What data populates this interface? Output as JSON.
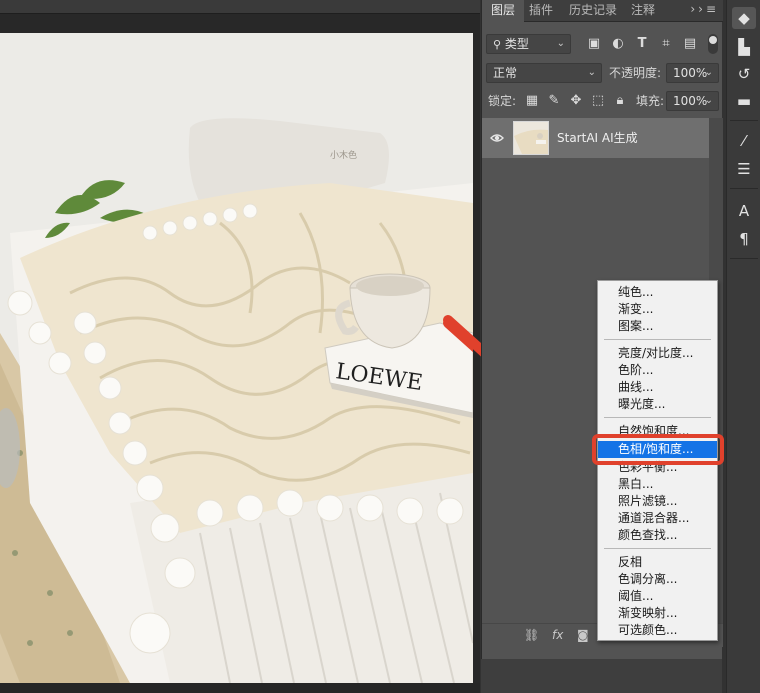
{
  "panel_tabs": [
    "图层",
    "插件",
    "历史记录",
    "注释"
  ],
  "panel_tab_icons": [
    "collapse-icon",
    "panel-menu-icon"
  ],
  "filter_kind": "类型",
  "blend_mode": "正常",
  "opacity_label": "不透明度:",
  "opacity_value": "100%",
  "lock_label": "锁定:",
  "fill_label": "填充:",
  "fill_value": "100%",
  "layer": {
    "name": "StartAI AI生成",
    "visible": true
  },
  "adjustment_menu": {
    "groups": [
      [
        "纯色...",
        "渐变...",
        "图案..."
      ],
      [
        "亮度/对比度...",
        "色阶...",
        "曲线...",
        "曝光度..."
      ],
      [
        "自然饱和度...",
        "色相/饱和度...",
        "色彩平衡...",
        "黑白...",
        "照片滤镜...",
        "通道混合器...",
        "颜色查找..."
      ],
      [
        "反相",
        "色调分离...",
        "阈值...",
        "渐变映射...",
        "可选颜色..."
      ]
    ],
    "selected": "色相/饱和度..."
  },
  "book_text": "LOEWE",
  "pillow_text": "小木色",
  "colors": {
    "accent_selection": "#1473e6",
    "annotation_red": "#e0412c",
    "panel_bg": "#535353"
  }
}
